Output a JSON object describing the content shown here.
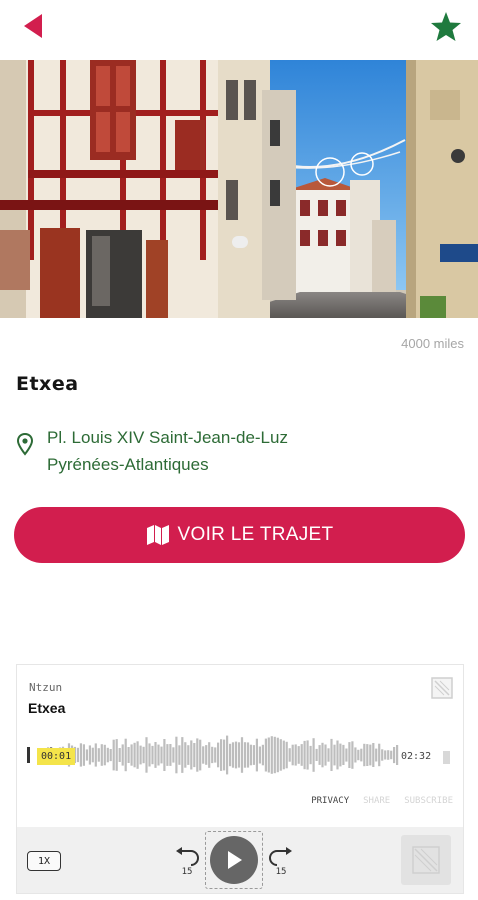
{
  "colors": {
    "accent": "#d21e4e",
    "green": "#2d6b36",
    "star": "#1f7a3e"
  },
  "header": {
    "back_icon": "back-arrow-icon",
    "favorite_icon": "star-icon"
  },
  "hero": {
    "image_subject": "street-photo"
  },
  "place": {
    "distance": "4000 miles",
    "name": "Etxea",
    "address_line1": "Pl. Louis XIV Saint-Jean-de-Luz",
    "address_line2": "Pyrénées-Atlantiques"
  },
  "route_button": {
    "label": "VOIR LE TRAJET",
    "icon": "map-icon"
  },
  "player": {
    "show_name": "Ntzun",
    "episode_title": "Etxea",
    "current_time": "00:01",
    "duration": "02:32",
    "progress": 0.01,
    "links": {
      "privacy": "PRIVACY",
      "share": "SHARE",
      "subscribe": "SUBSCRIBE"
    },
    "speed": "1X",
    "rewind_seconds": "15",
    "forward_seconds": "15"
  }
}
